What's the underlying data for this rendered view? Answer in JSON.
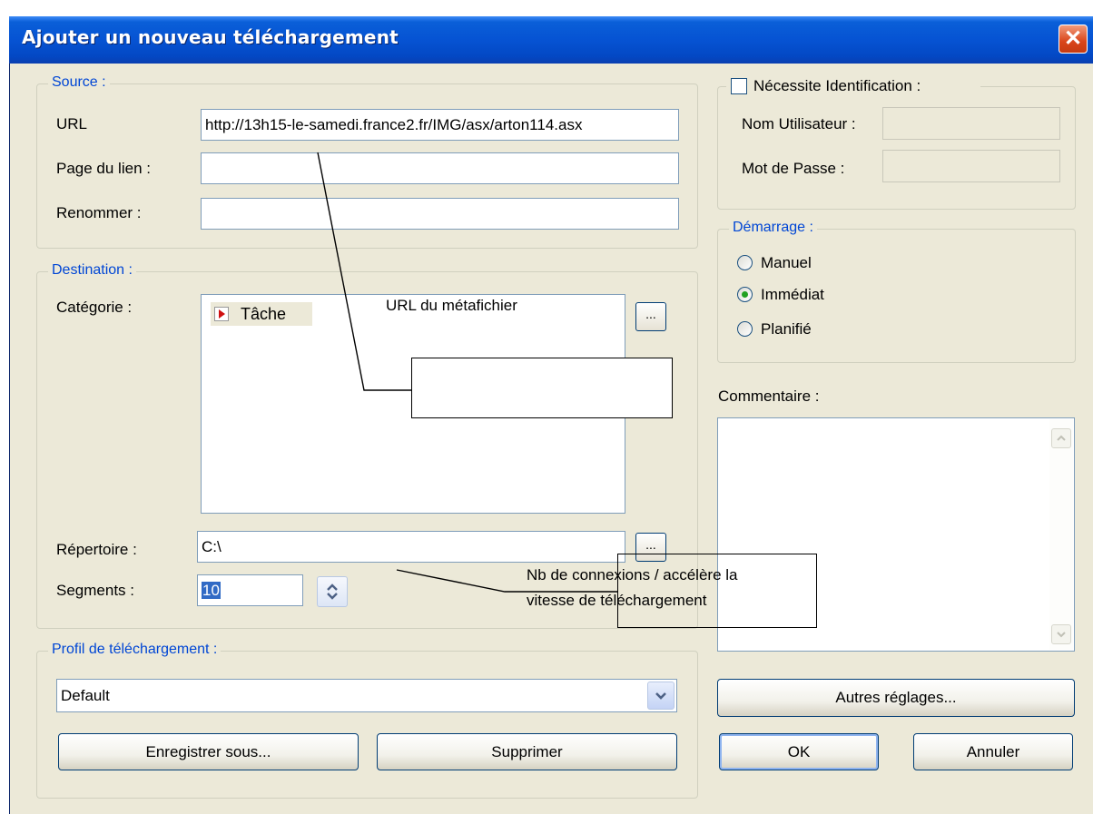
{
  "window": {
    "title": "Ajouter un nouveau téléchargement",
    "close_glyph": "✕"
  },
  "source": {
    "legend": "Source :",
    "url_label": "URL",
    "url_value": "http://13h15-le-samedi.france2.fr/IMG/asx/arton114.asx",
    "referer_label": "Page du lien :",
    "referer_value": "",
    "rename_label": "Renommer :",
    "rename_value": ""
  },
  "destination": {
    "legend": "Destination :",
    "category_label": "Catégorie :",
    "category_item": "Tâche",
    "category_icon": "task-arrow-icon",
    "browse_label": "...",
    "directory_label": "Répertoire :",
    "directory_value": "C:\\",
    "segments_label": "Segments :",
    "segments_value": "10"
  },
  "profile": {
    "legend": "Profil de téléchargement :",
    "selected": "Default",
    "save_as_label": "Enregistrer sous...",
    "delete_label": "Supprimer"
  },
  "auth": {
    "checkbox_label": "Nécessite Identification :",
    "checked": false,
    "username_label": "Nom Utilisateur :",
    "password_label": "Mot de Passe :"
  },
  "startup": {
    "legend": "Démarrage :",
    "options": [
      "Manuel",
      "Immédiat",
      "Planifié"
    ],
    "selected": "Immédiat"
  },
  "comment": {
    "label": "Commentaire :"
  },
  "buttons": {
    "more_settings": "Autres réglages...",
    "ok": "OK",
    "cancel": "Annuler"
  },
  "annotations": {
    "url_note": "URL du métafichier",
    "segments_note_line1": "Nb de connexions / accélère la",
    "segments_note_line2": "vitesse de téléchargement"
  },
  "colors": {
    "title_bar": "#0653d3",
    "dialog_bg": "#ece9d8",
    "legend_text": "#0046d5",
    "radio_dot": "#21a121"
  }
}
